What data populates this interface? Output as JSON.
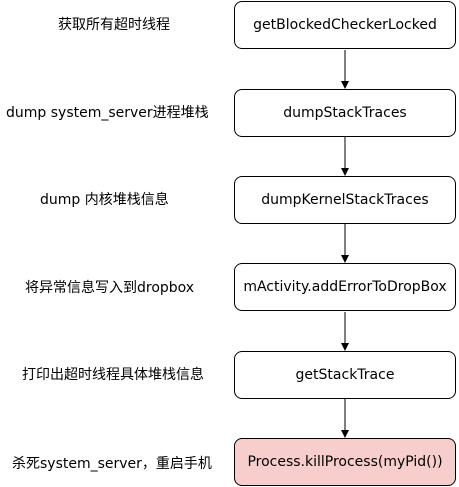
{
  "steps": [
    {
      "label": "获取所有超时线程",
      "node": "getBlockedCheckerLocked",
      "highlight": false
    },
    {
      "label": "dump system_server进程堆栈",
      "node": "dumpStackTraces",
      "highlight": false
    },
    {
      "label": "dump 内核堆栈信息",
      "node": "dumpKernelStackTraces",
      "highlight": false
    },
    {
      "label": "将异常信息写入到dropbox",
      "node": "mActivity.addErrorToDropBox",
      "highlight": false
    },
    {
      "label": "打印出超时线程具体堆栈信息",
      "node": "getStackTrace",
      "highlight": false
    },
    {
      "label": "杀死system_server，重启手机",
      "node": "Process.killProcess(myPid())",
      "highlight": true
    }
  ],
  "colors": {
    "highlight_fill": "#f8cecc",
    "border": "#000000",
    "arrow": "#000000"
  }
}
